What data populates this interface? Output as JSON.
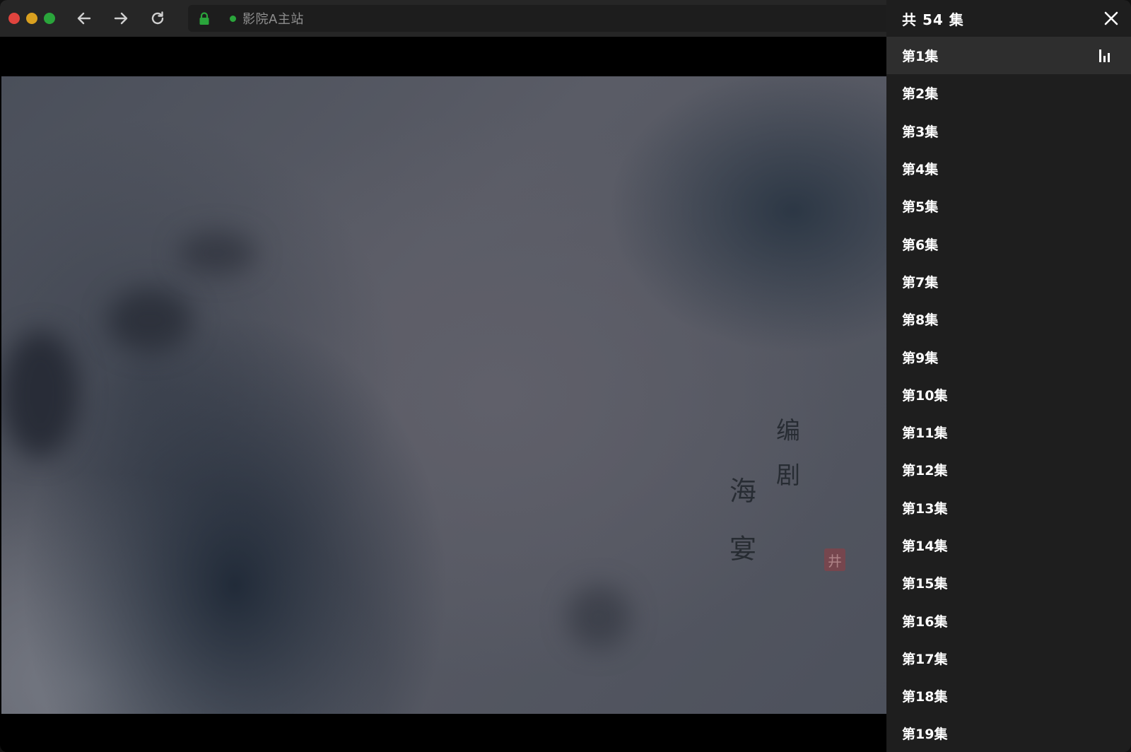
{
  "browser": {
    "traffic_lights": {
      "close_color": "#e0443e",
      "minimize_color": "#d9a01f",
      "maximize_color": "#2aa53b"
    },
    "back_icon": "arrow-left-icon",
    "forward_icon": "arrow-right-icon",
    "reload_icon": "reload-icon",
    "address": {
      "secure_icon": "lock-icon",
      "secure_color": "#2aa53b",
      "status_dot_color": "#2aa53b",
      "site_name": "影院A主站"
    }
  },
  "video": {
    "credits": {
      "role": [
        "编",
        "剧"
      ],
      "name": [
        "海",
        "宴"
      ],
      "seal": "井"
    }
  },
  "episodes": {
    "title": "共 54 集",
    "close_icon": "close-icon",
    "playing_icon": "playing-bars-icon",
    "current_index": 0,
    "items": [
      "第1集",
      "第2集",
      "第3集",
      "第4集",
      "第5集",
      "第6集",
      "第7集",
      "第8集",
      "第9集",
      "第10集",
      "第11集",
      "第12集",
      "第13集",
      "第14集",
      "第15集",
      "第16集",
      "第17集",
      "第18集",
      "第19集"
    ]
  }
}
